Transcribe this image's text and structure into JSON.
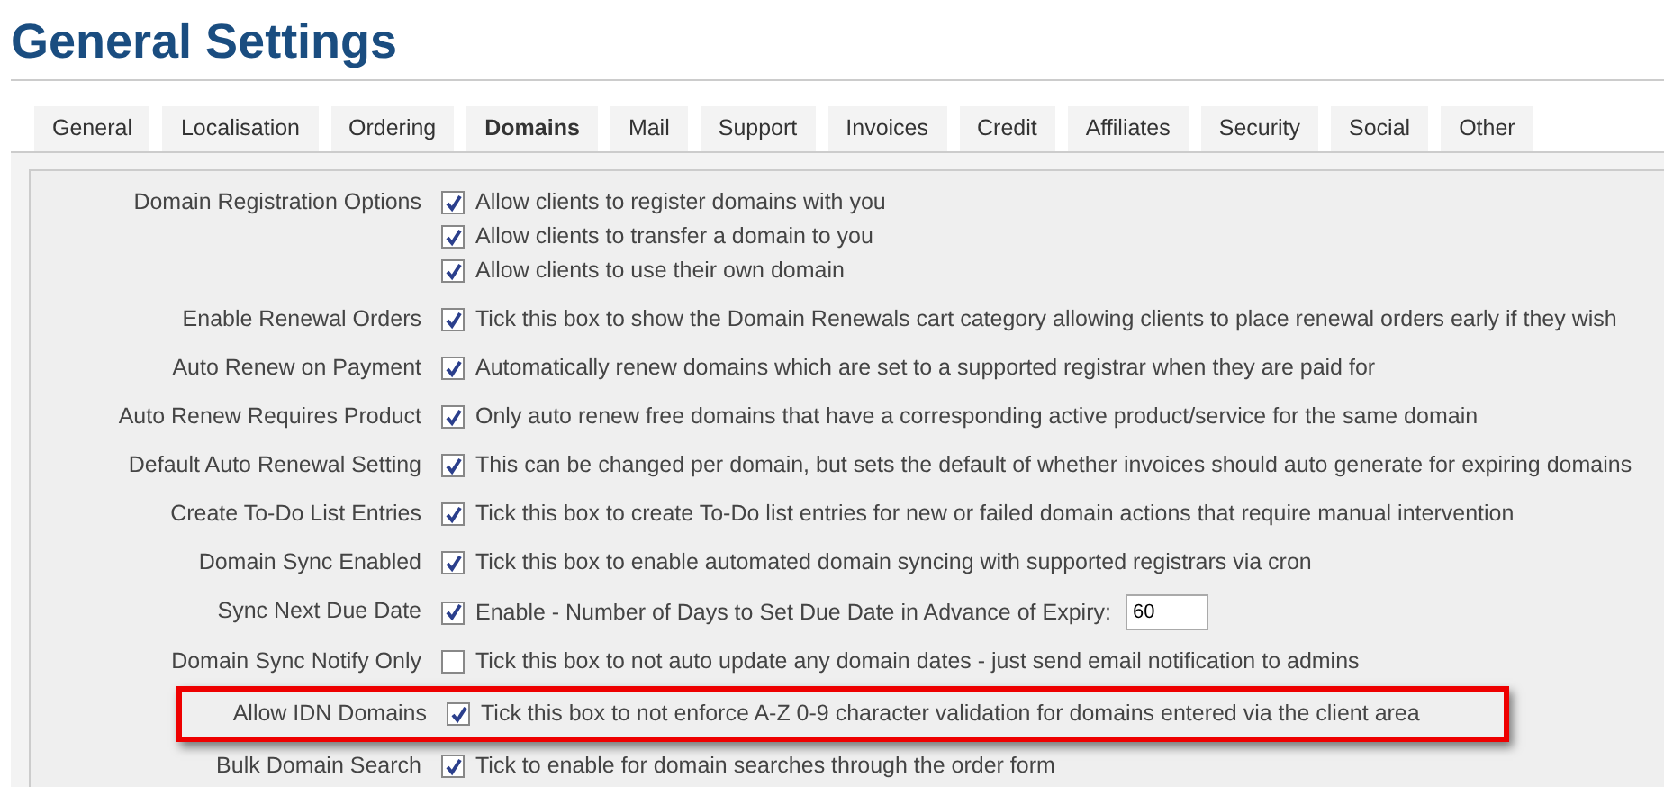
{
  "page_title": "General Settings",
  "tabs": [
    {
      "label": "General",
      "selected": false
    },
    {
      "label": "Localisation",
      "selected": false
    },
    {
      "label": "Ordering",
      "selected": false
    },
    {
      "label": "Domains",
      "selected": true
    },
    {
      "label": "Mail",
      "selected": false
    },
    {
      "label": "Support",
      "selected": false
    },
    {
      "label": "Invoices",
      "selected": false
    },
    {
      "label": "Credit",
      "selected": false
    },
    {
      "label": "Affiliates",
      "selected": false
    },
    {
      "label": "Security",
      "selected": false
    },
    {
      "label": "Social",
      "selected": false
    },
    {
      "label": "Other",
      "selected": false
    }
  ],
  "settings": [
    {
      "label": "Domain Registration Options",
      "highlighted": false,
      "options": [
        {
          "checked": true,
          "text": "Allow clients to register domains with you"
        },
        {
          "checked": true,
          "text": "Allow clients to transfer a domain to you"
        },
        {
          "checked": true,
          "text": "Allow clients to use their own domain"
        }
      ]
    },
    {
      "label": "Enable Renewal Orders",
      "highlighted": false,
      "options": [
        {
          "checked": true,
          "text": "Tick this box to show the Domain Renewals cart category allowing clients to place renewal orders early if they wish"
        }
      ]
    },
    {
      "label": "Auto Renew on Payment",
      "highlighted": false,
      "options": [
        {
          "checked": true,
          "text": "Automatically renew domains which are set to a supported registrar when they are paid for"
        }
      ]
    },
    {
      "label": "Auto Renew Requires Product",
      "highlighted": false,
      "options": [
        {
          "checked": true,
          "text": "Only auto renew free domains that have a corresponding active product/service for the same domain"
        }
      ]
    },
    {
      "label": "Default Auto Renewal Setting",
      "highlighted": false,
      "options": [
        {
          "checked": true,
          "text": "This can be changed per domain, but sets the default of whether invoices should auto generate for expiring domains"
        }
      ]
    },
    {
      "label": "Create To-Do List Entries",
      "highlighted": false,
      "options": [
        {
          "checked": true,
          "text": "Tick this box to create To-Do list entries for new or failed domain actions that require manual intervention"
        }
      ]
    },
    {
      "label": "Domain Sync Enabled",
      "highlighted": false,
      "options": [
        {
          "checked": true,
          "text": "Tick this box to enable automated domain syncing with supported registrars via cron"
        }
      ]
    },
    {
      "label": "Sync Next Due Date",
      "highlighted": false,
      "options": [
        {
          "checked": true,
          "text": "Enable - Number of Days to Set Due Date in Advance of Expiry:",
          "value": "60"
        }
      ]
    },
    {
      "label": "Domain Sync Notify Only",
      "highlighted": false,
      "options": [
        {
          "checked": false,
          "text": "Tick this box to not auto update any domain dates - just send email notification to admins"
        }
      ]
    },
    {
      "label": "Allow IDN Domains",
      "highlighted": true,
      "options": [
        {
          "checked": true,
          "text": "Tick this box to not enforce A-Z 0-9 character validation for domains entered via the client area"
        }
      ]
    },
    {
      "label": "Bulk Domain Search",
      "highlighted": false,
      "options": [
        {
          "checked": true,
          "text": "Tick to enable for domain searches through the order form"
        }
      ]
    }
  ]
}
